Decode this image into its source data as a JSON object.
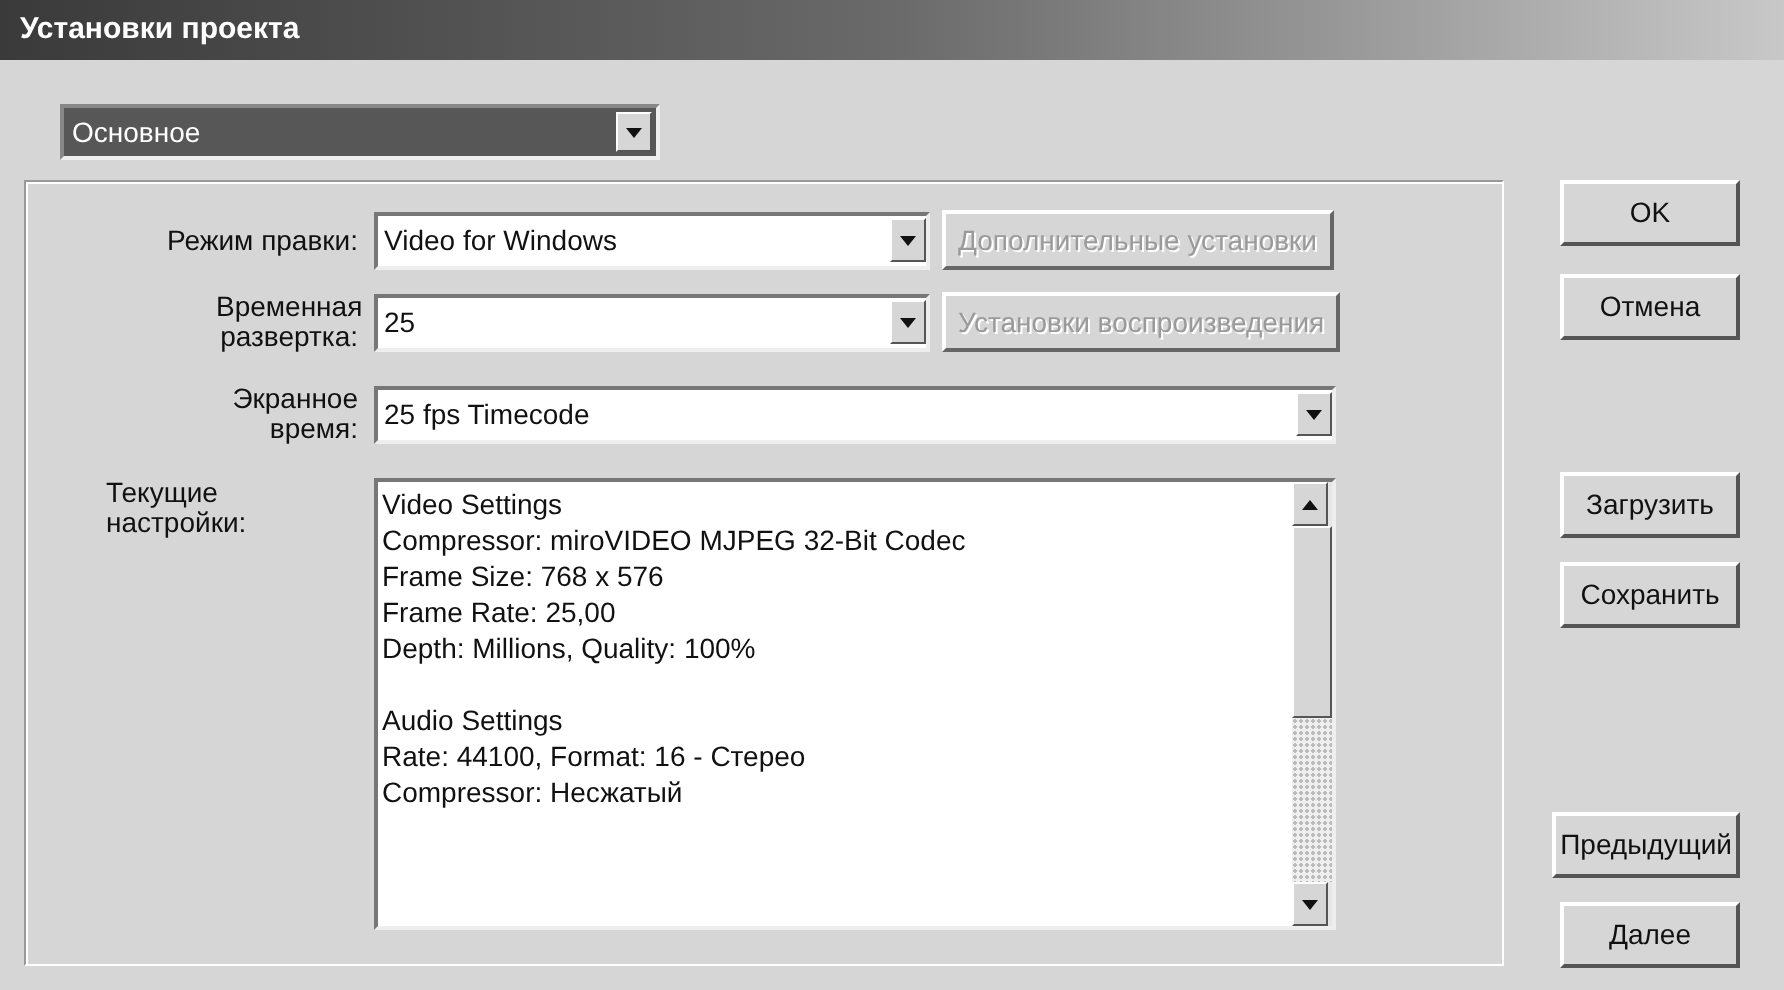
{
  "window": {
    "title": "Установки проекта"
  },
  "section_select": {
    "value": "Основное"
  },
  "fields": [
    {
      "label": "Режим правки:",
      "value": "Video for Windows",
      "button": {
        "label": "Дополнительные установки",
        "disabled": true
      }
    },
    {
      "label": "Временная развертка:",
      "value": "25",
      "button": {
        "label": "Установки воспроизведения",
        "disabled": true
      }
    },
    {
      "label": "Экранное время:",
      "value": "25 fps Timecode"
    }
  ],
  "current_settings": {
    "label": "Текущие настройки:",
    "sections": [
      {
        "title": "Video Settings",
        "lines": [
          "Compressor: miroVIDEO MJPEG 32-Bit Codec",
          "Frame Size: 768 x 576",
          "Frame Rate: 25,00",
          "Depth: Millions, Quality: 100%"
        ]
      },
      {
        "title": "Audio Settings",
        "lines": [
          "Rate: 44100, Format: 16 - Стерео",
          "Compressor: Несжатый"
        ]
      }
    ]
  },
  "button_groups": [
    [
      {
        "label": "OK"
      },
      {
        "label": "Отмена"
      }
    ],
    [
      {
        "label": "Загрузить"
      },
      {
        "label": "Сохранить"
      }
    ],
    [
      {
        "label": "Предыдущий"
      },
      {
        "label": "Далее"
      }
    ]
  ]
}
